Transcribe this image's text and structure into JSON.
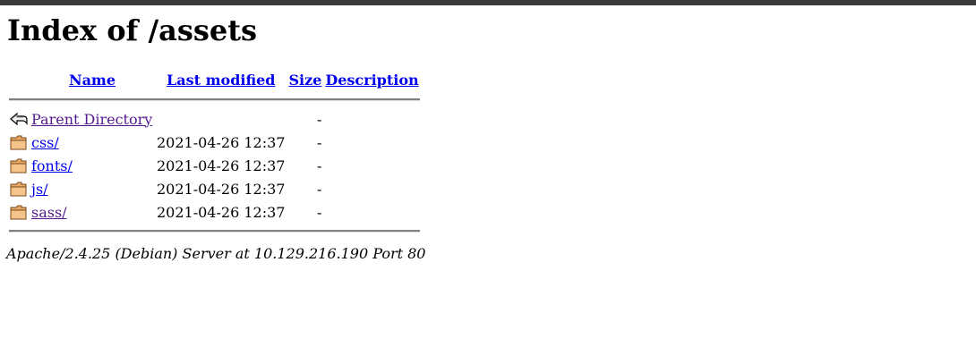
{
  "page_title": "Index of /assets",
  "headers": {
    "name": "Name",
    "last_modified": "Last modified",
    "size": "Size",
    "description": "Description"
  },
  "rows": [
    {
      "icon": "back-icon",
      "name": "Parent Directory",
      "modified": "",
      "size": "-",
      "description": "",
      "visited": true
    },
    {
      "icon": "folder-icon",
      "name": "css/",
      "modified": "2021-04-26 12:37",
      "size": "-",
      "description": "",
      "visited": false
    },
    {
      "icon": "folder-icon",
      "name": "fonts/",
      "modified": "2021-04-26 12:37",
      "size": "-",
      "description": "",
      "visited": false
    },
    {
      "icon": "folder-icon",
      "name": "js/",
      "modified": "2021-04-26 12:37",
      "size": "-",
      "description": "",
      "visited": false
    },
    {
      "icon": "folder-icon",
      "name": "sass/",
      "modified": "2021-04-26 12:37",
      "size": "-",
      "description": "",
      "visited": true
    }
  ],
  "footer": "Apache/2.4.25 (Debian) Server at 10.129.216.190 Port 80"
}
